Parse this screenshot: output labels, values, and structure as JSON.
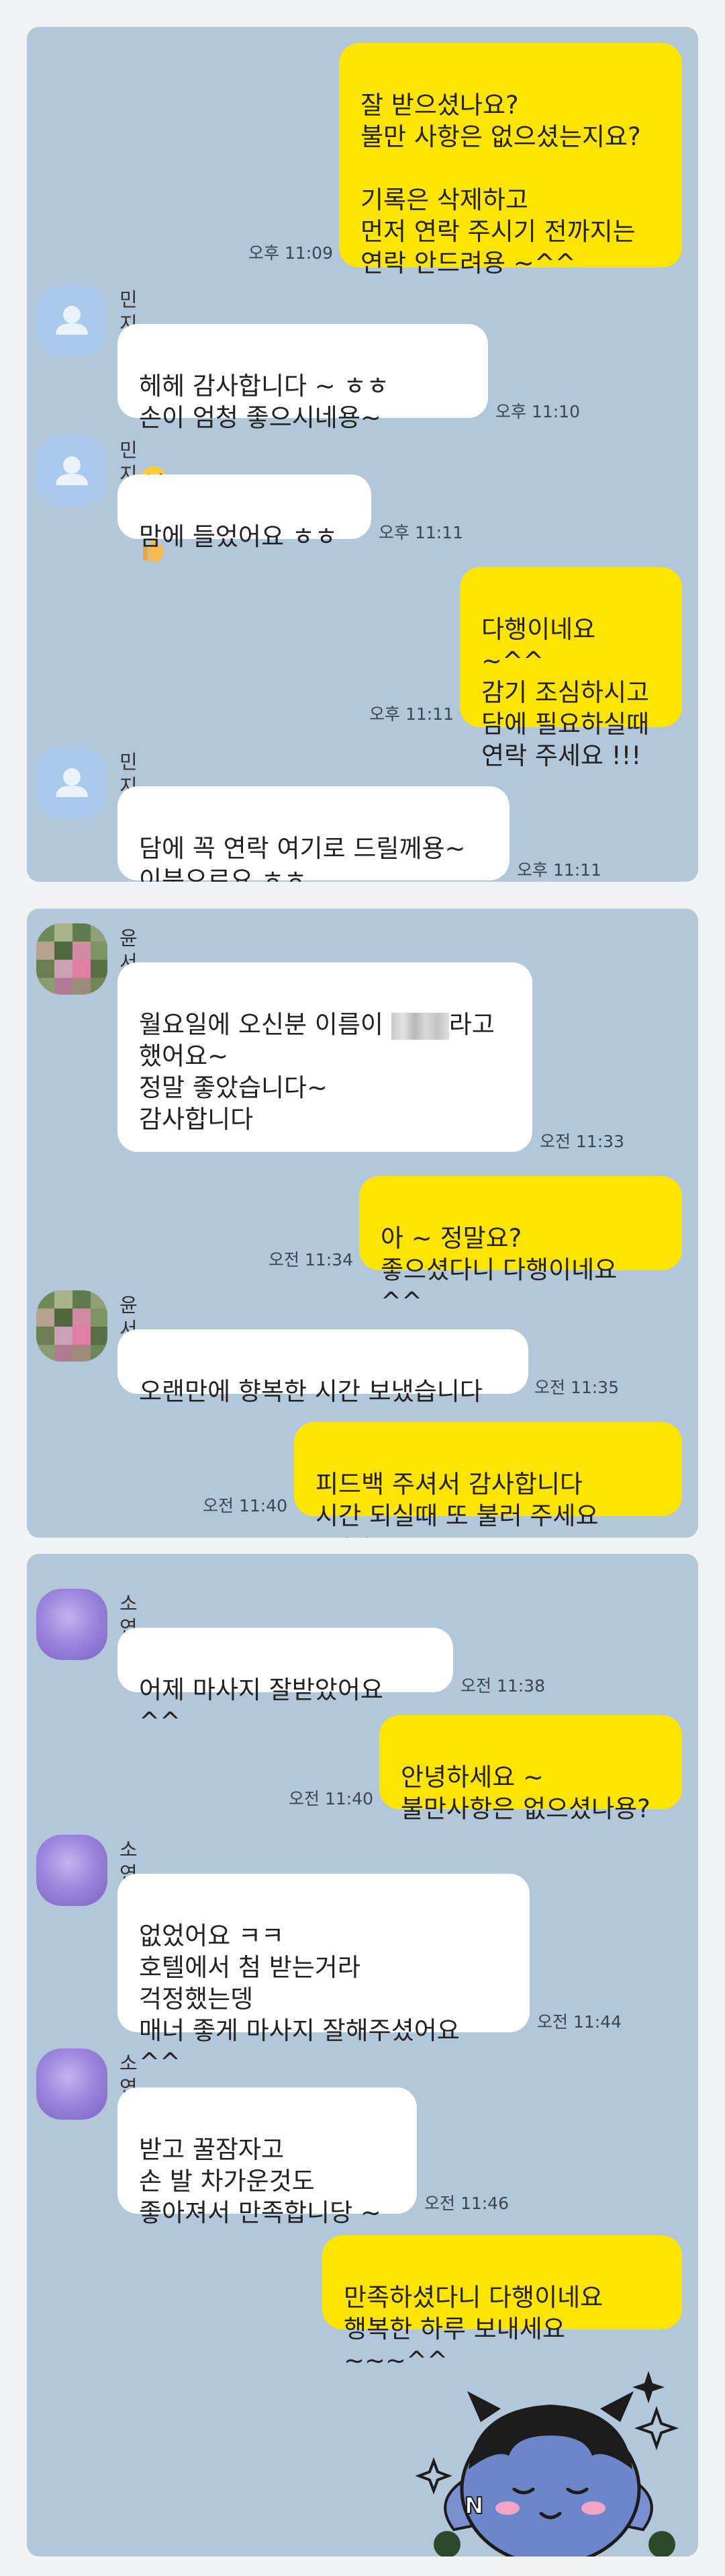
{
  "colors": {
    "chat_background": "#b2c7d9",
    "incoming_bubble": "#ffffff",
    "outgoing_bubble": "#fee500",
    "page_background": "#f2f3f5"
  },
  "chat1": {
    "m1": {
      "text": "잘 받으셨나요?\n불만 사항은 없으셨는지요?\n\n기록은 삭제하고\n먼저 연락 주시기 전까지는\n연락 안드려용 ~^^",
      "time": "오후 11:09"
    },
    "m2": {
      "name": "민지",
      "text": "헤헤 감사합니다 ~ ㅎㅎ\n손이 엄청 좋으시네용~",
      "emoji": "tongue-wink-emoji thumbs-up-emoji",
      "time": "오후 11:10"
    },
    "m3": {
      "name": "민지",
      "text": "맘에 들었어요 ㅎㅎ",
      "time": "오후 11:11"
    },
    "m4": {
      "text": "다행이네요 ~^^\n감기 조심하시고\n담에 필요하실때\n연락 주세요 !!!",
      "time": "오후 11:11"
    },
    "m5": {
      "name": "민지",
      "text": "담에 꼭 연락 여기로 드릴께용~\n이분으로요 ㅎㅎ",
      "time": "오후 11:11"
    }
  },
  "chat2": {
    "m1": {
      "name": "윤서",
      "text_before": "월요일에 오신분 이름이 ",
      "text_after": "라고\n했어요~\n정말 좋았습니다~\n감사합니다",
      "time": "오전 11:33"
    },
    "m2": {
      "text": "아 ~ 정말요?\n좋으셨다니 다행이네요 ^^",
      "time": "오전 11:34"
    },
    "m3": {
      "name": "윤서",
      "text": "오랜만에 향복한 시간 보냈습니다",
      "time": "오전 11:35"
    },
    "m4": {
      "text": "피드백 주셔서 감사합니다\n시간 되실때 또 불러 주세요 ~^^",
      "time": "오전 11:40"
    }
  },
  "chat3": {
    "m1": {
      "name": "소연",
      "text": "어제 마사지 잘받았어요 ^^",
      "time": "오전 11:38"
    },
    "m2": {
      "text": "안녕하세요 ~\n불만사항은 없으셨나용?",
      "time": "오전 11:40"
    },
    "m3": {
      "name": "소연",
      "text": "없었어요 ㅋㅋ\n호텔에서 첨 받는거라\n걱정했는뎅\n매너 좋게 마사지 잘해주셨어요 ^^",
      "time": "오전 11:44"
    },
    "m4": {
      "name": "소연",
      "text": "받고 꿀잠자고\n손 발 차가운것도\n좋아져서 만족합니당 ~",
      "time": "오전 11:46"
    },
    "m5": {
      "text": "만족하셨다니 다행이네요\n행복한 하루 보내세요 ~~~^^",
      "time": ""
    },
    "sticker": "kakao-friend-sticker"
  }
}
